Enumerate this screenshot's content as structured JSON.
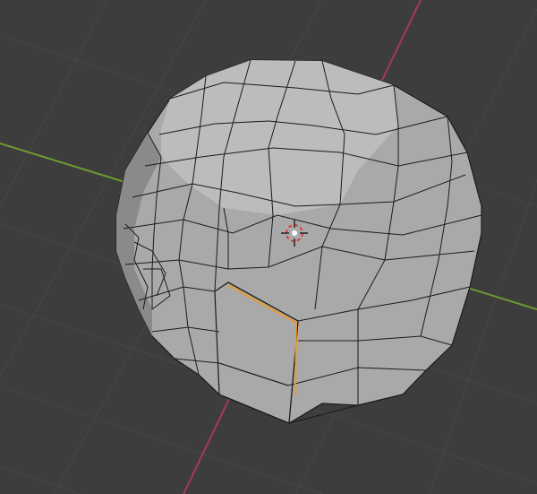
{
  "app": "blender-3d-viewport",
  "viewport": {
    "mode": "edit-mode",
    "selection": "edge-loop",
    "shading": "solid"
  },
  "colors": {
    "background": "#3d3d3d",
    "grid_line": "#474747",
    "x_axis": "#a83a4f",
    "y_axis": "#6e9a31",
    "mesh_face": "#a9a9a9",
    "mesh_face_light": "#bcbcbc",
    "mesh_face_shadow": "#8a8a8a",
    "mesh_wire": "#1b1b1b",
    "selected_edge": "#f39a1d",
    "cursor_red": "#e03a3a",
    "cursor_white": "#ffffff"
  },
  "icons": {
    "cursor": "3d-cursor-icon"
  }
}
